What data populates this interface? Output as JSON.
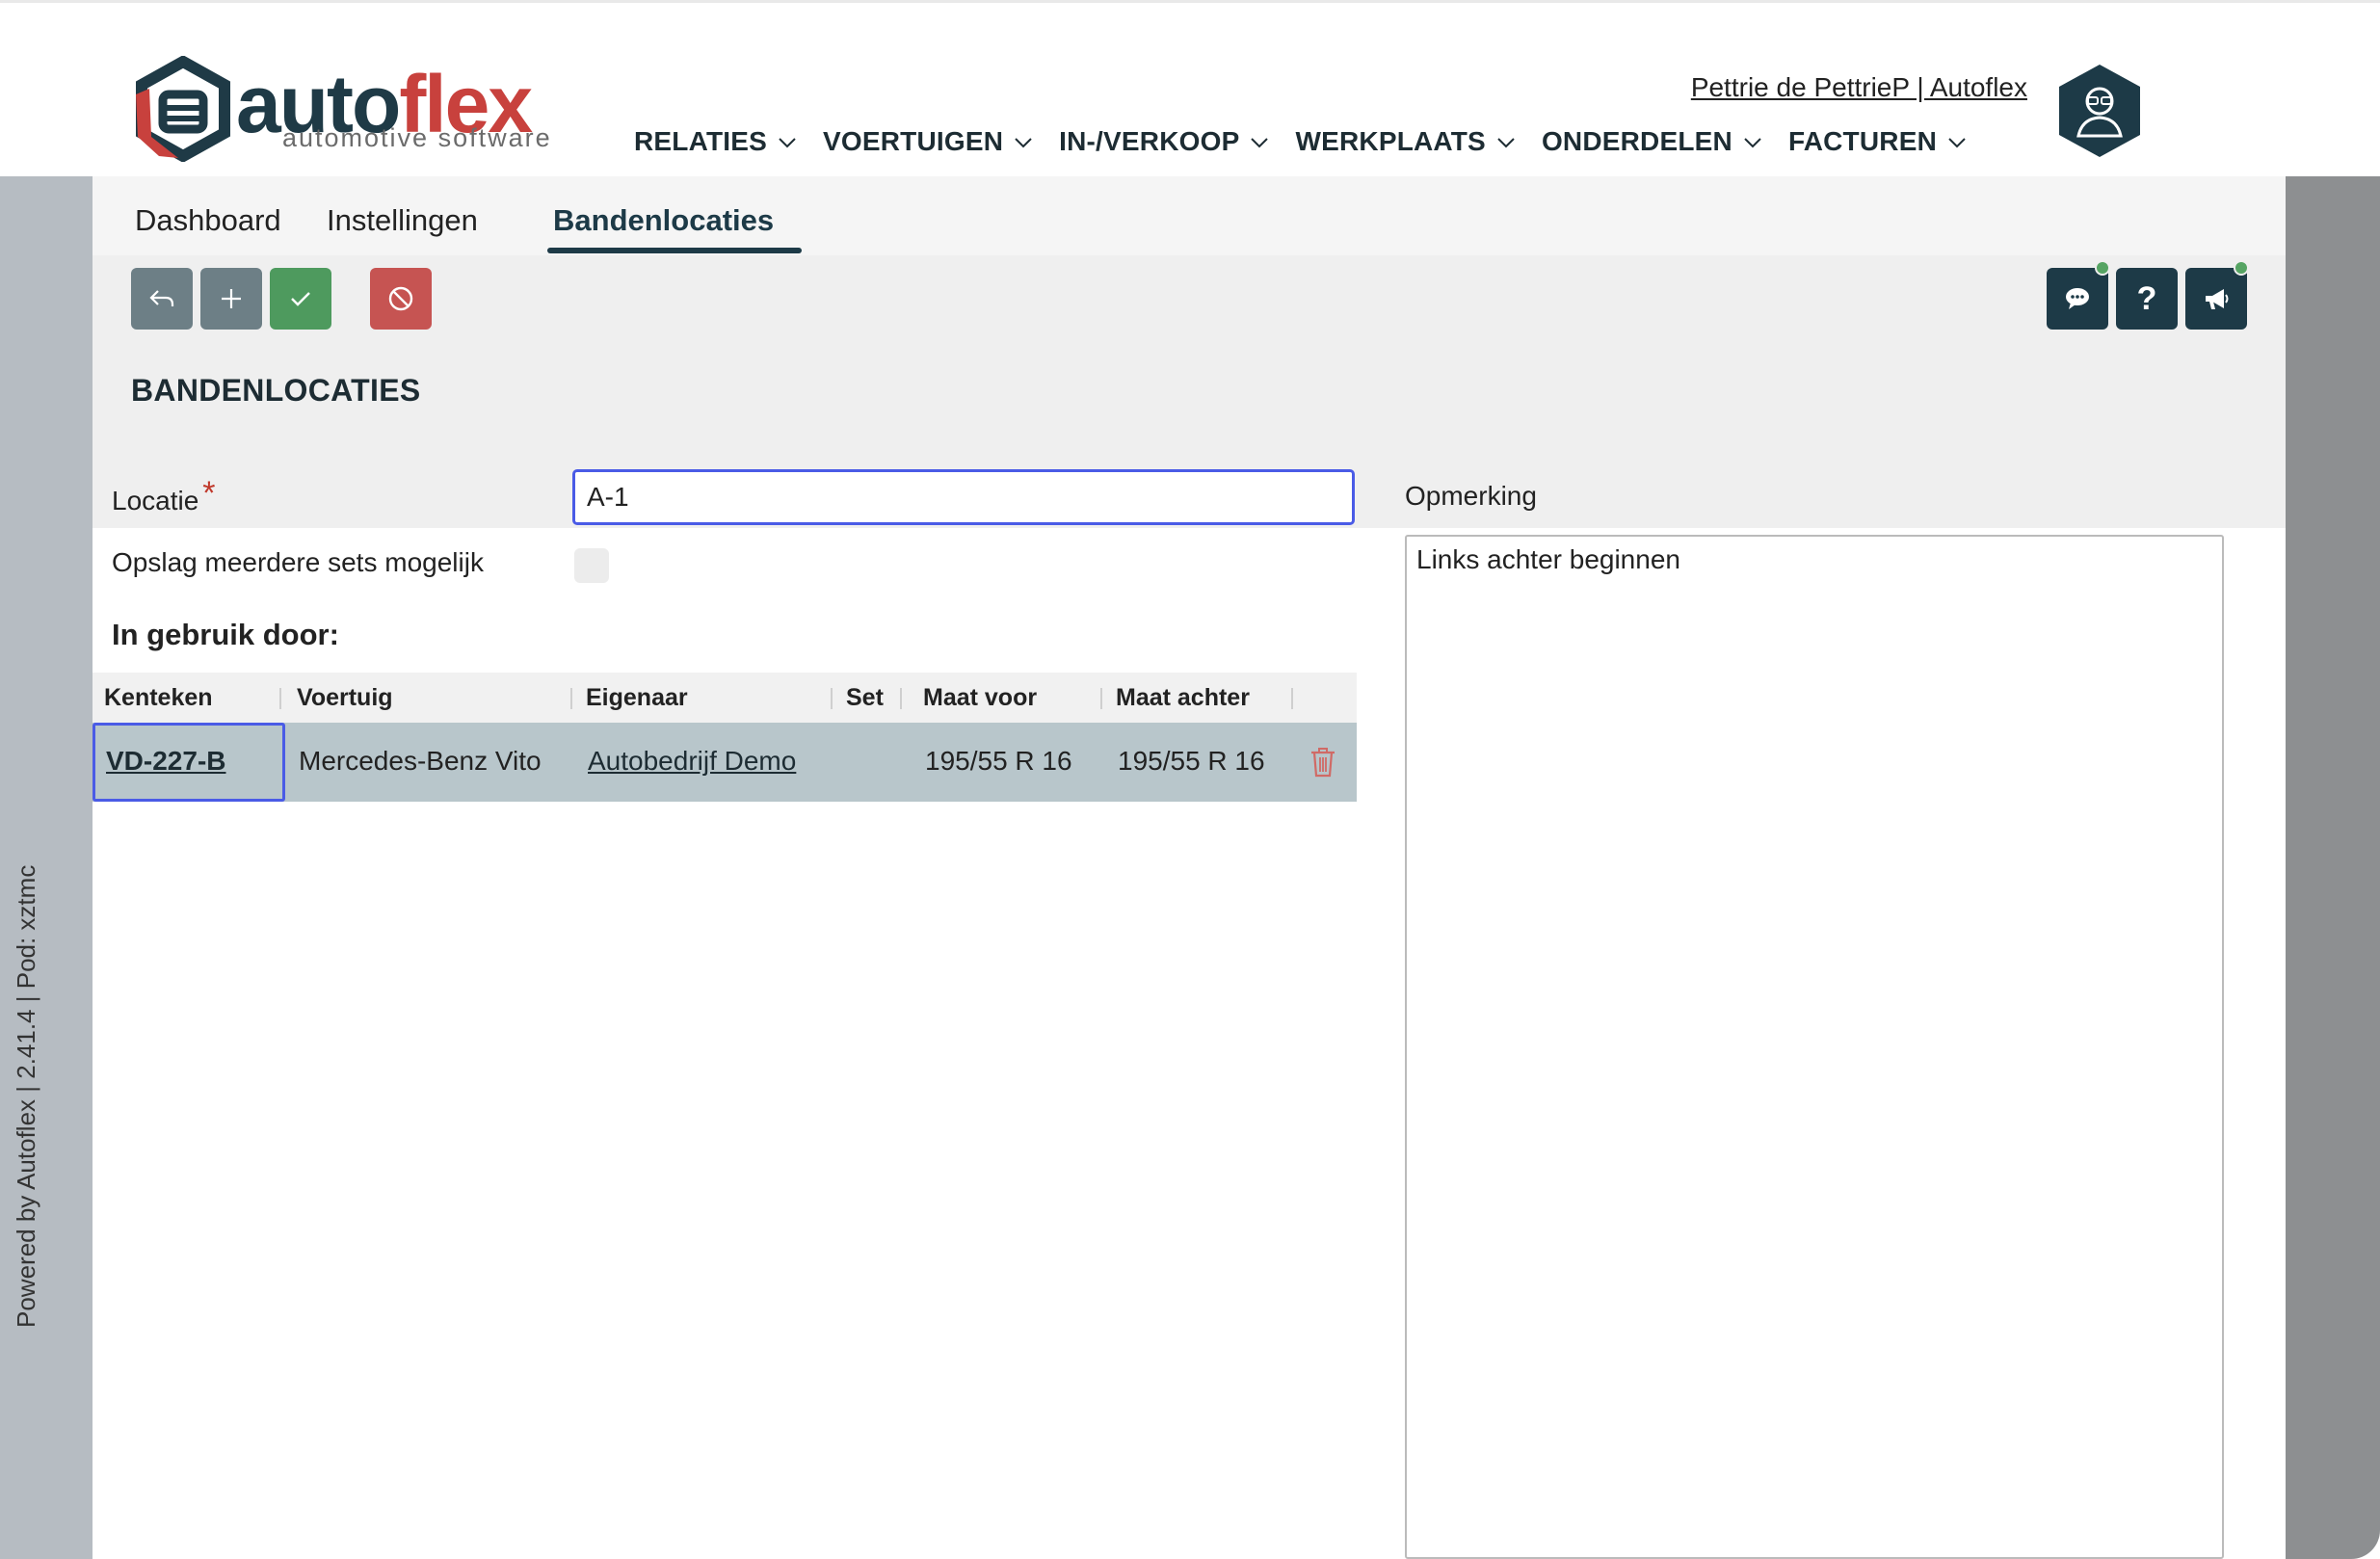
{
  "header": {
    "logo": {
      "part1": "auto",
      "part2": "flex",
      "tagline": "automotive software"
    },
    "user_link": "Pettrie de PettrieP | Autoflex",
    "nav": [
      {
        "label": "RELATIES"
      },
      {
        "label": "VOERTUIGEN"
      },
      {
        "label": "IN-/VERKOOP"
      },
      {
        "label": "WERKPLAATS"
      },
      {
        "label": "ONDERDELEN"
      },
      {
        "label": "FACTUREN"
      }
    ]
  },
  "sidebar": {
    "vertical_text": "Powered by Autoflex | 2.41.4 | Pod: xztmc"
  },
  "tabs": [
    {
      "label": "Dashboard"
    },
    {
      "label": "Instellingen"
    },
    {
      "label": "Bandenlocaties",
      "active": true
    }
  ],
  "toolbar": {
    "actions": [
      {
        "icon": "back-arrow-icon"
      },
      {
        "icon": "plus-icon"
      },
      {
        "icon": "check-icon"
      },
      {
        "icon": "cancel-icon"
      }
    ],
    "right_actions": [
      {
        "icon": "chat-icon",
        "notification": true
      },
      {
        "icon": "help-icon",
        "label": "?"
      },
      {
        "icon": "megaphone-icon",
        "notification": true
      }
    ]
  },
  "page": {
    "title": "BANDENLOCATIES"
  },
  "form": {
    "locatie_label": "Locatie",
    "required_mark": "*",
    "locatie_value": "A-1",
    "opslag_label": "Opslag meerdere sets mogelijk",
    "opslag_checked": false,
    "in_use_title": "In gebruik door:",
    "opmerking_label": "Opmerking",
    "opmerking_value": "Links achter beginnen"
  },
  "table": {
    "headers": {
      "kenteken": "Kenteken",
      "voertuig": "Voertuig",
      "eigenaar": "Eigenaar",
      "set": "Set",
      "maat_voor": "Maat voor",
      "maat_achter": "Maat achter"
    },
    "rows": [
      {
        "kenteken": "VD-227-B",
        "voertuig": "Mercedes-Benz Vito",
        "eigenaar": "Autobedrijf Demo",
        "set": "",
        "maat_voor": "195/55 R 16",
        "maat_achter": "195/55 R 16"
      }
    ]
  },
  "colors": {
    "brand_dark": "#1d3a47",
    "brand_red": "#c8413d",
    "accent_green": "#4e9a5e",
    "danger_red": "#c65452",
    "focus_blue": "#4a5be6",
    "row_highlight": "#b8c6cb"
  }
}
